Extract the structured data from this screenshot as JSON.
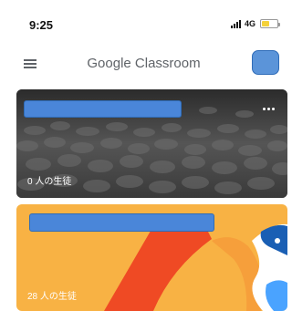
{
  "status_bar": {
    "time": "9:25",
    "network": "4G",
    "battery_level": 0.45,
    "battery_color": "#f5d23a"
  },
  "app_bar": {
    "menu_icon": "hamburger-menu-icon",
    "title": "Google Classroom",
    "avatar_color": "#5b94d9"
  },
  "classes": [
    {
      "student_count": "0 人の生徒",
      "theme": "cobblestone-dark",
      "more_icon": "more-horizontal-icon"
    },
    {
      "student_count": "28 人の生徒",
      "theme": "orange-illustration",
      "accent_color": "#f8b244"
    }
  ]
}
